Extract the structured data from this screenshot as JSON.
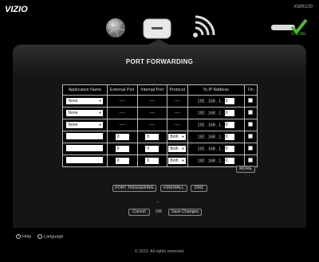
{
  "header": {
    "logo_text": "VIZIO",
    "model": "XWR100",
    "status": "ONLINE"
  },
  "nav": {
    "icons": [
      "globe-icon",
      "router-icon",
      "wifi-icon"
    ]
  },
  "page": {
    "title": "PORT FORWARDING"
  },
  "table": {
    "headers": [
      "Application Name",
      "External Port",
      "Internal Port",
      "Protocol",
      "To IP Address",
      "On"
    ],
    "rows": [
      {
        "app": "None",
        "ext": "----",
        "int": "----",
        "proto": "----",
        "ip": [
          "192",
          "168",
          "1",
          "0"
        ]
      },
      {
        "app": "None",
        "ext": "----",
        "int": "----",
        "proto": "----",
        "ip": [
          "192",
          "168",
          "1",
          "0"
        ]
      },
      {
        "app": "None",
        "ext": "----",
        "int": "----",
        "proto": "----",
        "ip": [
          "192",
          "168",
          "1",
          "0"
        ]
      },
      {
        "app": "",
        "ext": "0",
        "int": "0",
        "proto": "Both",
        "ip": [
          "192",
          "168",
          "1",
          "0"
        ]
      },
      {
        "app": "",
        "ext": "0",
        "int": "0",
        "proto": "Both",
        "ip": [
          "192",
          "168",
          "1",
          "0"
        ]
      },
      {
        "app": "",
        "ext": "0",
        "int": "0",
        "proto": "Both",
        "ip": [
          "192",
          "168",
          "1",
          "0"
        ]
      }
    ],
    "more_label": "MORE"
  },
  "tabs": {
    "triggering": "PORT TRIGGERING",
    "firewall": "FIREWALL",
    "dmz": "DMZ"
  },
  "actions": {
    "dash": "-",
    "cancel": "Cancel",
    "or": "OR",
    "save": "Save Changes"
  },
  "bottom": {
    "help": "Help",
    "language": "Language",
    "copyright": "© 2010. All rights reserved."
  },
  "colors": {
    "accent_green": "#4fb13a",
    "background": "#000000"
  }
}
